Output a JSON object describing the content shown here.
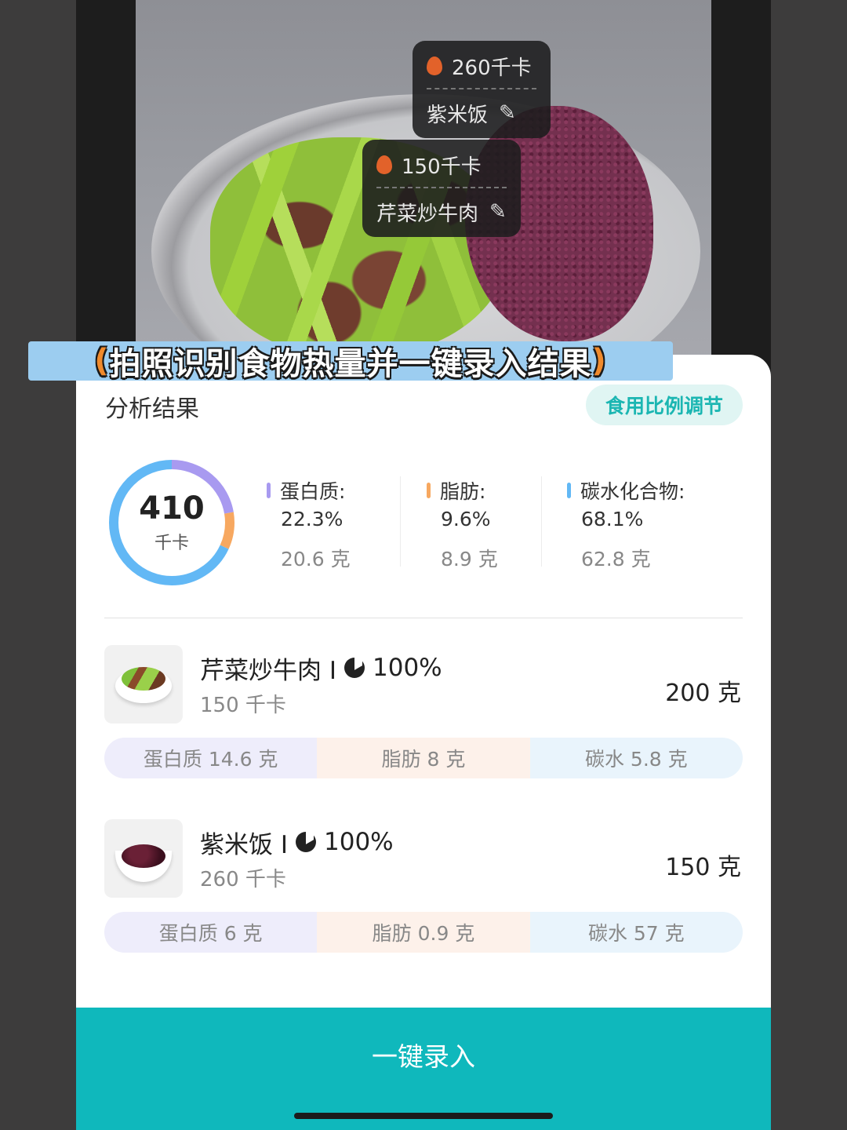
{
  "photo": {
    "tags": [
      {
        "kcal": "260千卡",
        "name": "紫米饭",
        "edit_icon": "pencil-icon"
      },
      {
        "kcal": "150千卡",
        "name": "芹菜炒牛肉",
        "edit_icon": "pencil-icon"
      }
    ]
  },
  "banner": {
    "open": "(",
    "text": "拍照识别食物热量并一键录入结果",
    "close": ")"
  },
  "sheet": {
    "title": "分析结果",
    "ratio_button": "食用比例调节",
    "summary": {
      "total_kcal": "410",
      "unit": "千卡",
      "ring_segments": [
        {
          "name": "蛋白质",
          "fraction": 0.223,
          "color": "#a89af0"
        },
        {
          "name": "脂肪",
          "fraction": 0.096,
          "color": "#f7a860"
        },
        {
          "name": "碳水化合物",
          "fraction": 0.681,
          "color": "#62b8f5"
        }
      ]
    },
    "macros": [
      {
        "label": "蛋白质:",
        "pct": "22.3%",
        "grams": "20.6 克",
        "color": "#a89af0"
      },
      {
        "label": "脂肪:",
        "pct": "9.6%",
        "grams": "8.9 克",
        "color": "#f7a860"
      },
      {
        "label": "碳水化合物:",
        "pct": "68.1%",
        "grams": "62.8 克",
        "color": "#62b8f5"
      }
    ],
    "items": [
      {
        "name": "芹菜炒牛肉 I",
        "portion": "100%",
        "kcal": "150 千卡",
        "weight": "200 克",
        "protein": "蛋白质 14.6 克",
        "fat": "脂肪 8 克",
        "carbs": "碳水 5.8 克"
      },
      {
        "name": "紫米饭 I",
        "portion": "100%",
        "kcal": "260 千卡",
        "weight": "150 克",
        "protein": "蛋白质 6 克",
        "fat": "脂肪 0.9 克",
        "carbs": "碳水 57 克"
      }
    ],
    "submit_button": "一键录入"
  }
}
